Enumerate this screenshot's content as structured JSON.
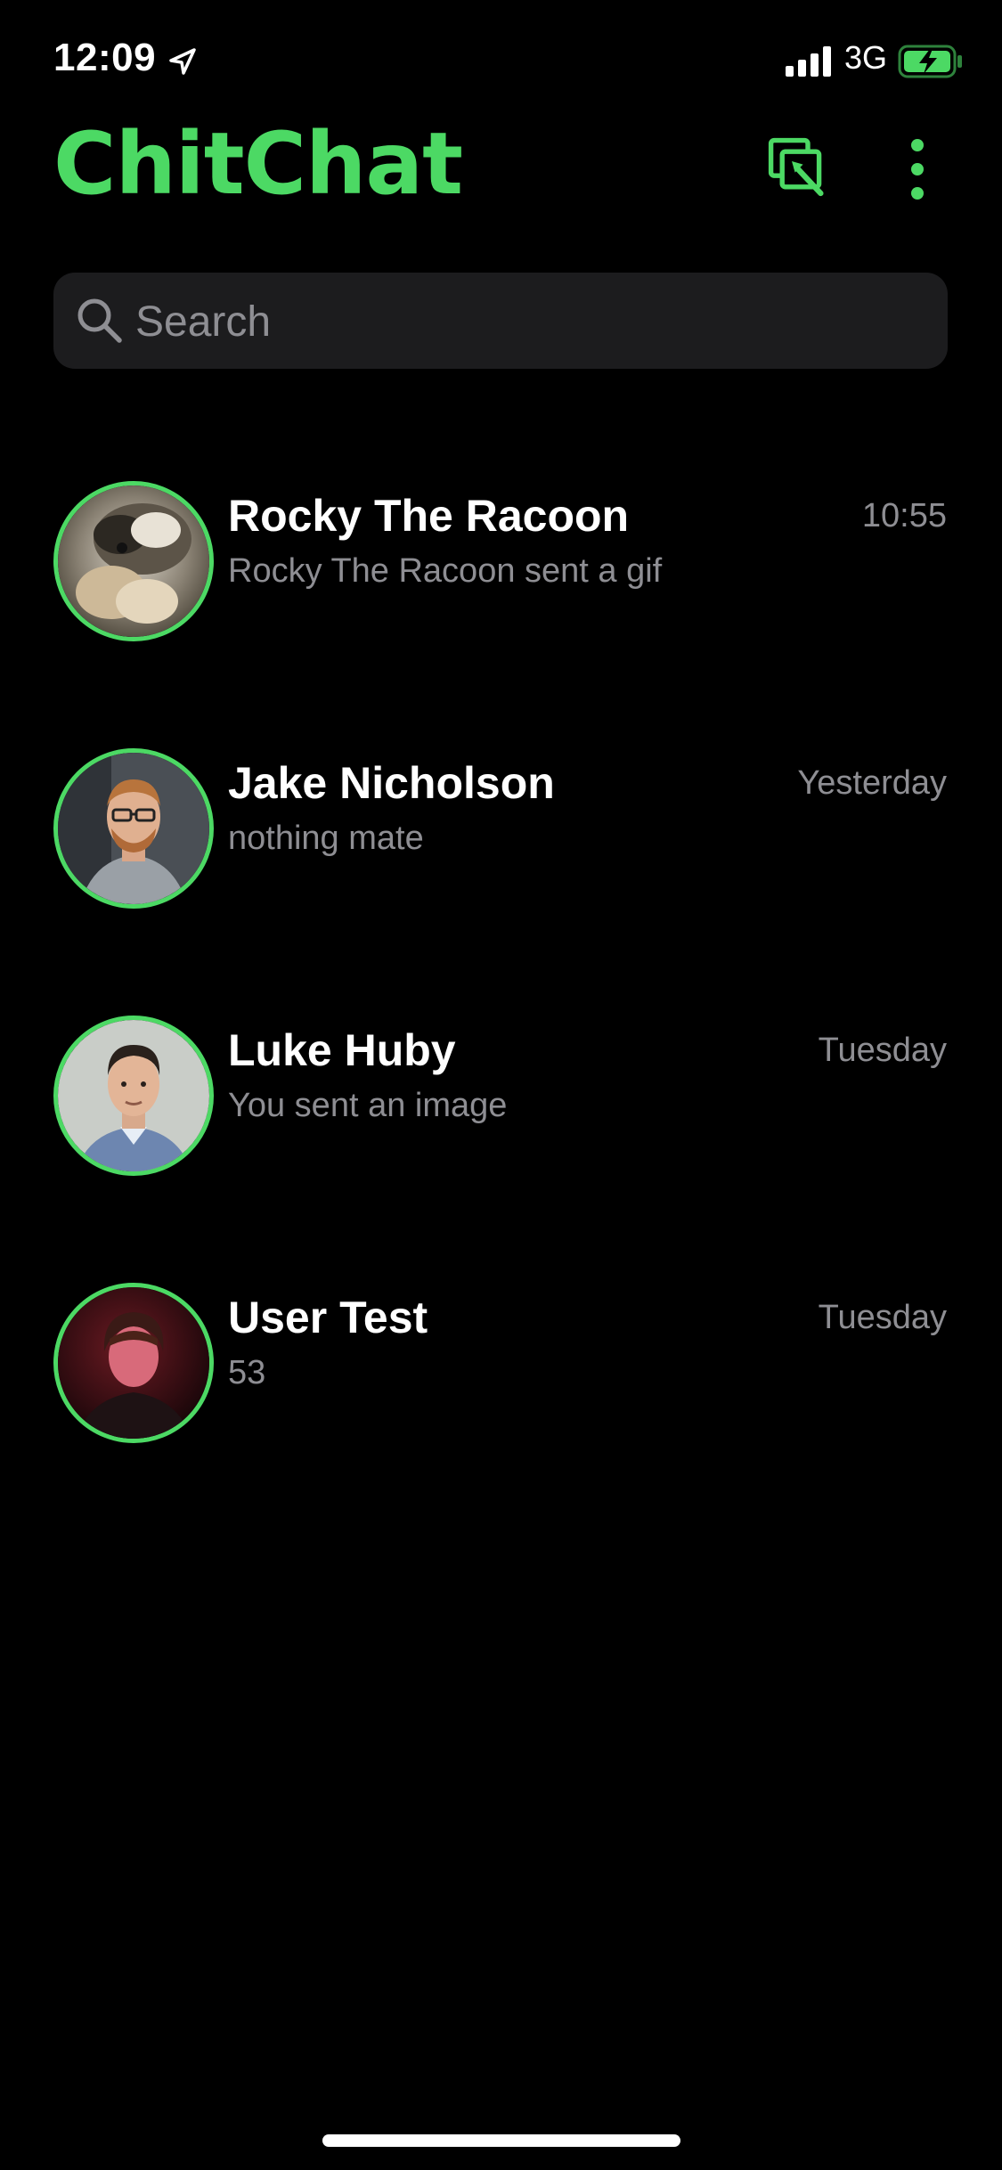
{
  "status_bar": {
    "time": "12:09",
    "network": "3G",
    "icons": [
      "location-arrow-icon",
      "signal-bars-icon",
      "battery-charging-icon"
    ]
  },
  "header": {
    "title": "ChitChat",
    "compose_icon": "compose-icon",
    "more_icon": "more-vertical-icon"
  },
  "search": {
    "placeholder": "Search",
    "value": ""
  },
  "chats": [
    {
      "name": "Rocky The Racoon",
      "preview": "Rocky The Racoon sent a gif",
      "time": "10:55",
      "avatar": "racoon-photo"
    },
    {
      "name": "Jake Nicholson",
      "preview": "nothing mate",
      "time": "Yesterday",
      "avatar": "man-with-glasses-photo"
    },
    {
      "name": "Luke Huby",
      "preview": "You sent an image",
      "time": "Tuesday",
      "avatar": "man-portrait-photo"
    },
    {
      "name": "User Test",
      "preview": "53",
      "time": "Tuesday",
      "avatar": "person-red-light-photo"
    }
  ],
  "colors": {
    "accent": "#4cd964",
    "background": "#000000",
    "search_background": "#1c1c1e",
    "secondary_text": "#8e8e93",
    "primary_text": "#ffffff"
  }
}
